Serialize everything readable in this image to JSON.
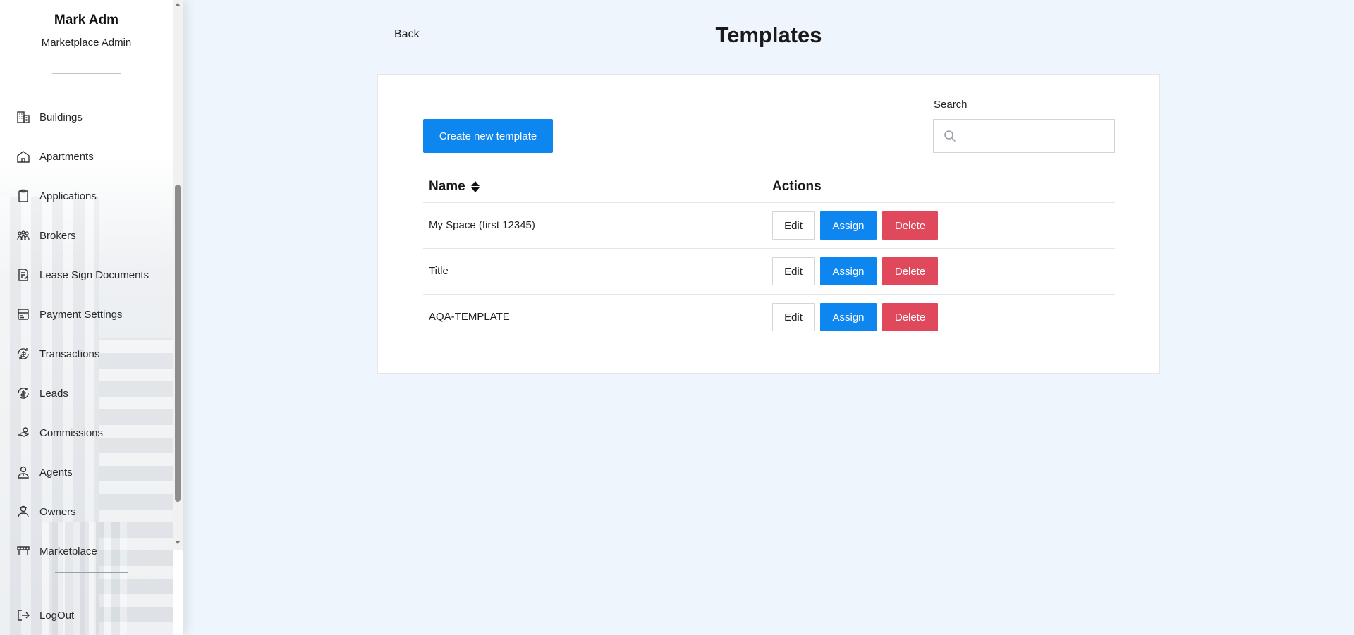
{
  "user": {
    "name": "Mark Adm",
    "role": "Marketplace Admin"
  },
  "sidebar": {
    "items": [
      {
        "label": "Buildings",
        "icon": "buildings-icon"
      },
      {
        "label": "Apartments",
        "icon": "house-icon"
      },
      {
        "label": "Applications",
        "icon": "clipboard-icon"
      },
      {
        "label": "Brokers",
        "icon": "brokers-icon"
      },
      {
        "label": "Lease Sign Documents",
        "icon": "document-sign-icon"
      },
      {
        "label": "Payment Settings",
        "icon": "payment-settings-icon"
      },
      {
        "label": "Transactions",
        "icon": "transactions-icon"
      },
      {
        "label": "Leads",
        "icon": "leads-icon"
      },
      {
        "label": "Commissions",
        "icon": "commissions-icon"
      },
      {
        "label": "Agents",
        "icon": "agent-icon"
      },
      {
        "label": "Owners",
        "icon": "owner-icon"
      },
      {
        "label": "Marketplace",
        "icon": "marketplace-icon"
      }
    ],
    "logout": "LogOut"
  },
  "header": {
    "back": "Back",
    "title": "Templates"
  },
  "toolbar": {
    "create_label": "Create new template",
    "search_label": "Search",
    "search_value": ""
  },
  "table": {
    "columns": [
      "Name",
      "Actions"
    ],
    "rows": [
      {
        "name": "My Space (first 12345)"
      },
      {
        "name": "Title"
      },
      {
        "name": "AQA-TEMPLATE"
      }
    ],
    "actions": {
      "edit": "Edit",
      "assign": "Assign",
      "delete": "Delete"
    }
  },
  "colors": {
    "primary": "#0d86f0",
    "danger": "#e0485b",
    "background": "#eef5fc"
  }
}
